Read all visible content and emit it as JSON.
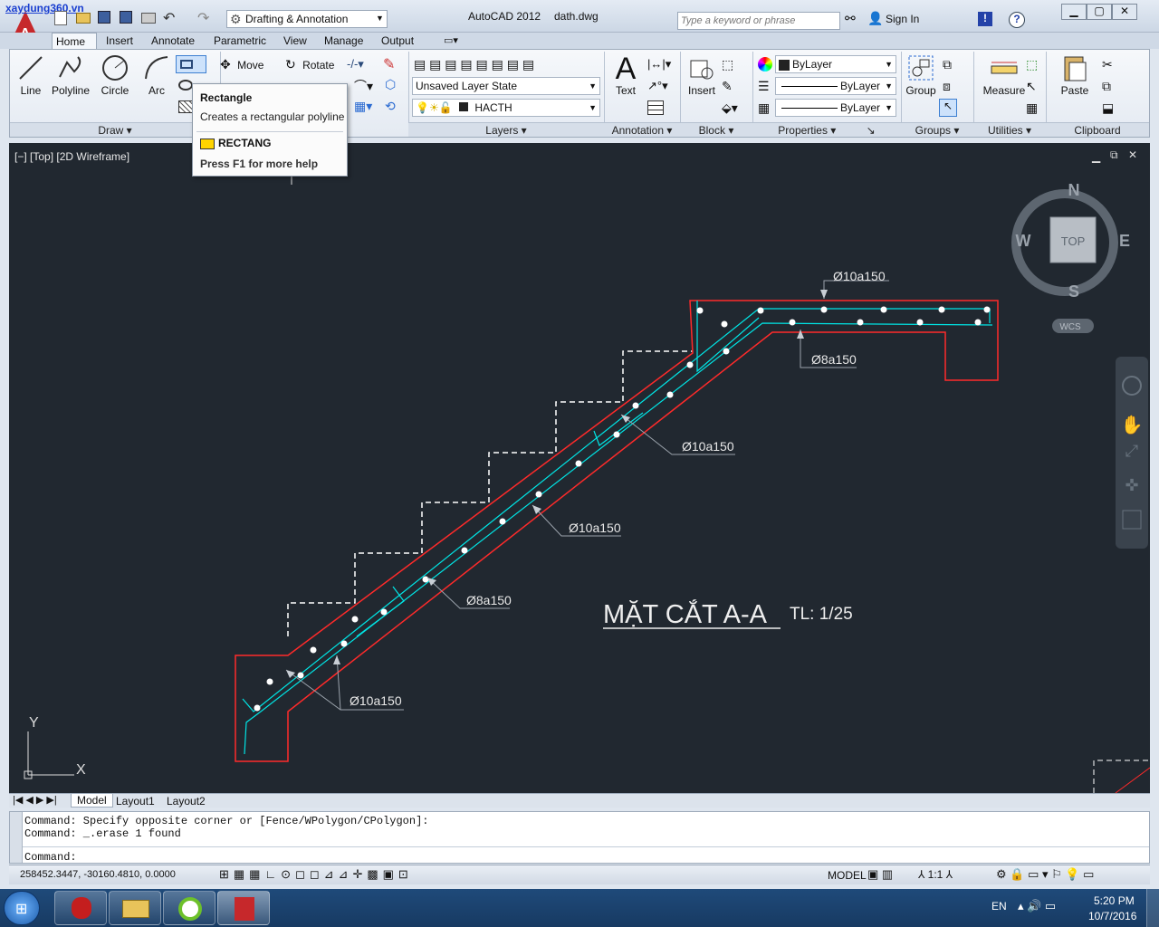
{
  "titlebar": {
    "watermark": "xaydung360.vn",
    "workspace": "Drafting & Annotation",
    "app_title": "AutoCAD 2012",
    "file_name": "dath.dwg",
    "search_placeholder": "Type a keyword or phrase",
    "sign_in": "Sign In"
  },
  "ribbon_tabs": [
    "Home",
    "Insert",
    "Annotate",
    "Parametric",
    "View",
    "Manage",
    "Output"
  ],
  "draw_panel": {
    "line": "Line",
    "polyline": "Polyline",
    "circle": "Circle",
    "arc": "Arc",
    "title": "Draw"
  },
  "modify_panel": {
    "move": "Move",
    "rotate": "Rotate"
  },
  "layers_panel": {
    "layer_state": "Unsaved Layer State",
    "current_layer": "HACTH",
    "title": "Layers"
  },
  "annotation_panel": {
    "text": "Text",
    "title": "Annotation"
  },
  "block_panel": {
    "insert": "Insert",
    "title": "Block"
  },
  "properties_panel": {
    "color": "ByLayer",
    "linetype": "ByLayer",
    "lineweight": "ByLayer",
    "title": "Properties"
  },
  "groups_panel": {
    "group": "Group",
    "title": "Groups"
  },
  "utilities_panel": {
    "measure": "Measure",
    "title": "Utilities"
  },
  "clipboard_panel": {
    "paste": "Paste",
    "title": "Clipboard"
  },
  "tooltip": {
    "title": "Rectangle",
    "description": "Creates a rectangular polyline",
    "command": "RECTANG",
    "help": "Press F1 for more help"
  },
  "viewport": {
    "label": "[−] [Top] [2D Wireframe]"
  },
  "viewcube": {
    "n": "N",
    "s": "S",
    "e": "E",
    "w": "W",
    "top": "TOP",
    "wcs": "WCS"
  },
  "drawing": {
    "title": "MẶT CẮT A-A",
    "scale": "TL: 1/25",
    "labels": [
      "Ø10a150",
      "Ø8a150",
      "Ø10a150",
      "Ø10a150",
      "Ø8a150",
      "Ø10a150"
    ]
  },
  "ucs": {
    "x": "X",
    "y": "Y"
  },
  "layout_tabs": [
    "Model",
    "Layout1",
    "Layout2"
  ],
  "command": {
    "line1": "Command: Specify opposite corner or [Fence/WPolygon/CPolygon]:",
    "line2": "Command: _.erase 1 found",
    "prompt": "Command:"
  },
  "status": {
    "coords": "258452.3447, -30160.4810, 0.0000",
    "model": "MODEL",
    "scale": "1:1"
  },
  "taskbar": {
    "lang": "EN",
    "time": "5:20 PM",
    "date": "10/7/2016"
  },
  "colors": {
    "drawing_bg": "#212830",
    "rebar": "#00e5e5",
    "outline": "#ff2a2a",
    "dashed": "#ffffff"
  }
}
